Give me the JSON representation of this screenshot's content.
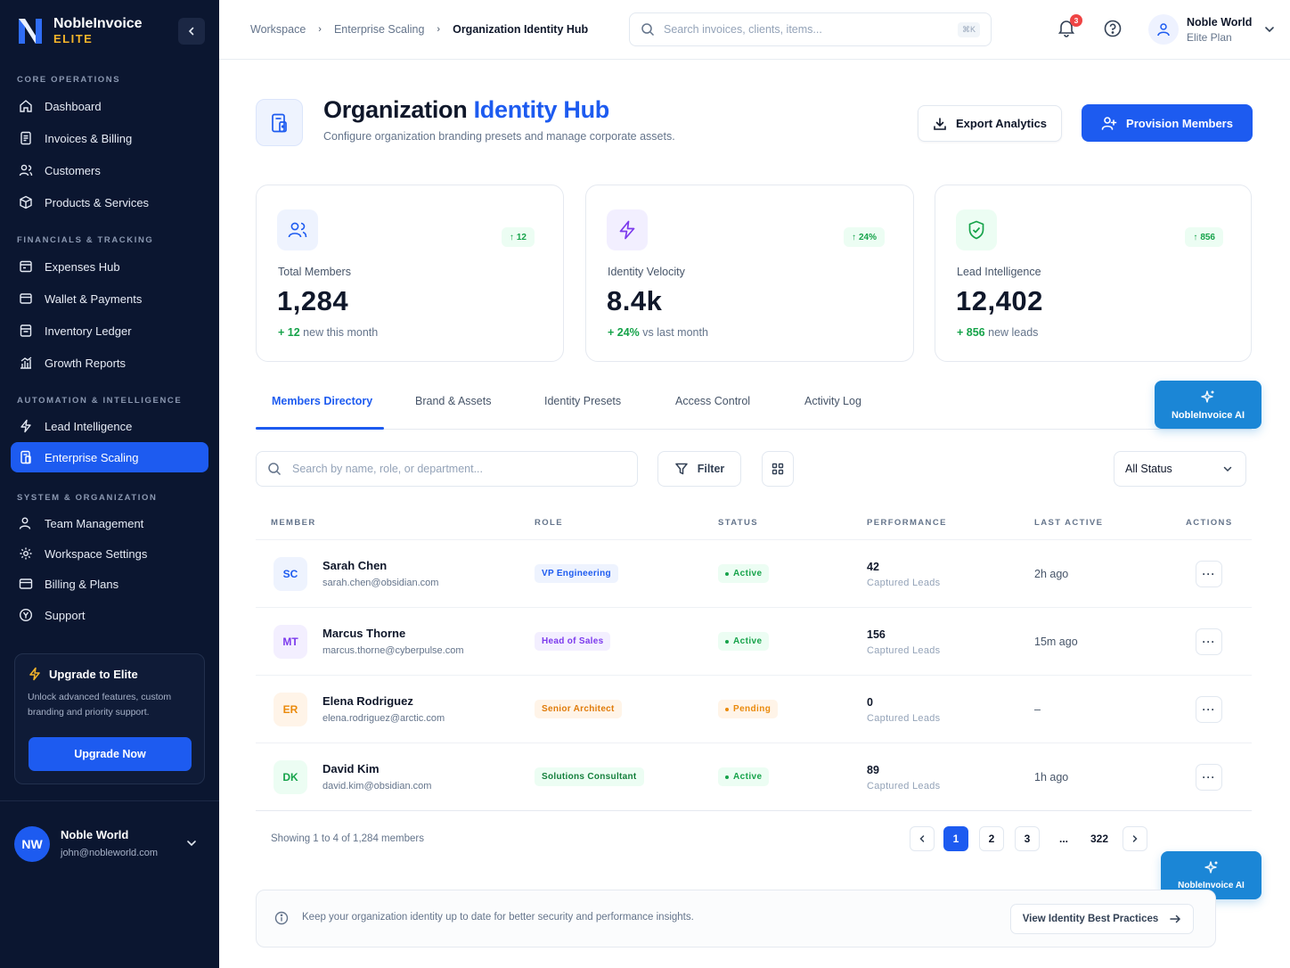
{
  "brand": {
    "name": "NobleInvoice",
    "tier": "ELITE"
  },
  "sidebar": {
    "sections": [
      {
        "title": "CORE OPERATIONS",
        "items": [
          {
            "label": "Dashboard",
            "icon": "home-icon"
          },
          {
            "label": "Invoices & Billing",
            "icon": "invoice-icon"
          },
          {
            "label": "Customers",
            "icon": "users-icon"
          },
          {
            "label": "Products & Services",
            "icon": "box-icon"
          }
        ]
      },
      {
        "title": "FINANCIALS & TRACKING",
        "items": [
          {
            "label": "Expenses Hub",
            "icon": "receipt-icon"
          },
          {
            "label": "Wallet & Payments",
            "icon": "wallet-icon"
          },
          {
            "label": "Inventory Ledger",
            "icon": "ledger-icon"
          },
          {
            "label": "Growth Reports",
            "icon": "chart-icon"
          }
        ]
      },
      {
        "title": "AUTOMATION & INTELLIGENCE",
        "items": [
          {
            "label": "Lead Intelligence",
            "icon": "bolt-icon"
          },
          {
            "label": "Enterprise Scaling",
            "icon": "building-icon",
            "active": true
          }
        ]
      },
      {
        "title": "SYSTEM & ORGANIZATION",
        "items": [
          {
            "label": "Team Management",
            "icon": "team-icon"
          },
          {
            "label": "Workspace Settings",
            "icon": "gear-icon"
          },
          {
            "label": "Billing & Plans",
            "icon": "card-icon"
          },
          {
            "label": "Support",
            "icon": "support-icon"
          }
        ]
      }
    ],
    "upgrade": {
      "title": "Upgrade to Elite",
      "description": "Unlock advanced features, custom branding and priority support.",
      "button": "Upgrade Now"
    },
    "user": {
      "initials": "NW",
      "name": "Noble World",
      "email": "john@nobleworld.com"
    }
  },
  "topbar": {
    "breadcrumbs": [
      "Workspace",
      "Enterprise Scaling",
      "Organization Identity Hub"
    ],
    "search_placeholder": "Search invoices, clients, items...",
    "search_shortcut": "⌘K",
    "notifications_count": "3",
    "user": {
      "name": "Noble World",
      "plan": "Elite Plan"
    }
  },
  "header": {
    "title_main": "Organization",
    "title_accent": "Identity Hub",
    "subtitle": "Configure organization branding presets and manage corporate assets.",
    "export_label": "Export Analytics",
    "provision_label": "Provision Members"
  },
  "stats": [
    {
      "label": "Total Members",
      "value": "1,284",
      "chip": "12",
      "foot_value": "+ 12",
      "foot_text": " new this month"
    },
    {
      "label": "Identity Velocity",
      "value": "8.4k",
      "chip": "24%",
      "foot_value": "+ 24%",
      "foot_text": " vs last month"
    },
    {
      "label": "Lead Intelligence",
      "value": "12,402",
      "chip": "856",
      "foot_value": "+ 856",
      "foot_text": " new leads"
    }
  ],
  "tabs": [
    "Members Directory",
    "Brand & Assets",
    "Identity Presets",
    "Access Control",
    "Activity Log"
  ],
  "ai_button": "NobleInvoice AI",
  "toolbar": {
    "search_placeholder": "Search by name, role, or department...",
    "filter_label": "Filter",
    "status_select": "All Status"
  },
  "table": {
    "headers": [
      "MEMBER",
      "ROLE",
      "STATUS",
      "PERFORMANCE",
      "LAST ACTIVE",
      "ACTIONS"
    ],
    "rows": [
      {
        "initials": "SC",
        "name": "Sarah Chen",
        "email": "sarah.chen@obsidian.com",
        "role": "VP Engineering",
        "role_tone": "blue",
        "status": "Active",
        "perf": "42",
        "perf_label": "Captured Leads",
        "last_active": "2h ago",
        "menu": "···"
      },
      {
        "initials": "MT",
        "name": "Marcus Thorne",
        "email": "marcus.thorne@cyberpulse.com",
        "role": "Head of Sales",
        "role_tone": "purple",
        "status": "Active",
        "perf": "156",
        "perf_label": "Captured Leads",
        "last_active": "15m ago",
        "menu": "···"
      },
      {
        "initials": "ER",
        "name": "Elena Rodriguez",
        "email": "elena.rodriguez@arctic.com",
        "role": "Senior Architect",
        "role_tone": "orange",
        "status": "Pending",
        "perf": "0",
        "perf_label": "Captured Leads",
        "last_active": "–",
        "menu": "···"
      },
      {
        "initials": "DK",
        "name": "David Kim",
        "email": "david.kim@obsidian.com",
        "role": "Solutions Consultant",
        "role_tone": "green",
        "status": "Active",
        "perf": "89",
        "perf_label": "Captured Leads",
        "last_active": "1h ago",
        "menu": "···"
      }
    ]
  },
  "pagination": {
    "showing": "Showing 1 to 4 of 1,284 members",
    "pages": [
      "1",
      "2",
      "3",
      "...",
      "322"
    ],
    "active": "1"
  },
  "info_bar": {
    "text": "Keep your organization identity up to date for better security and performance insights.",
    "button": "View Identity Best Practices"
  },
  "colors": {
    "accent": "#1d5bf0",
    "sidebar_bg": "#0b1630",
    "success": "#16a34a",
    "warning": "#ea8a0c",
    "ai": "#1b86d6"
  }
}
